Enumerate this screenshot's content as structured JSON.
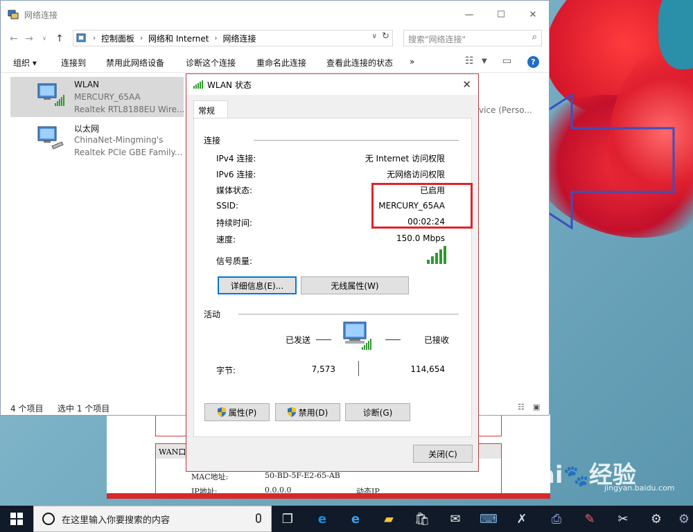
{
  "explorer": {
    "title": "网络连接",
    "window_controls": [
      "—",
      "☐",
      "✕"
    ],
    "breadcrumb": [
      "控制面板",
      "网络和 Internet",
      "网络连接"
    ],
    "search_placeholder": "搜索\"网络连接\"",
    "commands": [
      "组织 ▾",
      "连接到",
      "禁用此网络设备",
      "诊断这个连接",
      "重命名此连接",
      "查看此连接的状态",
      "»"
    ],
    "items": [
      {
        "name": "WLAN",
        "sub1": "MERCURY_65AA",
        "sub2": "Realtek RTL8188EU Wire...",
        "selected": true
      },
      {
        "name": "以太网",
        "sub1": "ChinaNet-Mingming's",
        "sub2": "Realtek PCIe GBE Family..."
      }
    ],
    "trailing_text": "vice (Perso...",
    "status_count": "4 个项目",
    "status_selected": "选中 1 个项目"
  },
  "dialog": {
    "title": "WLAN 状态",
    "tab": "常规",
    "connection_group": "连接",
    "rows": [
      {
        "label": "IPv4 连接:",
        "value": "无 Internet 访问权限"
      },
      {
        "label": "IPv6 连接:",
        "value": "无网络访问权限"
      },
      {
        "label": "媒体状态:",
        "value": "已启用"
      },
      {
        "label": "SSID:",
        "value": "MERCURY_65AA"
      },
      {
        "label": "持续时间:",
        "value": "00:02:24"
      },
      {
        "label": "速度:",
        "value": "150.0 Mbps"
      }
    ],
    "signal_label": "信号质量:",
    "signal_bars": 5,
    "details_button": "详细信息(E)...",
    "wireless_button": "无线属性(W)",
    "activity_group": "活动",
    "sent_label": "已发送",
    "received_label": "已接收",
    "bytes_label": "字节:",
    "bytes_sent": "7,573",
    "bytes_received": "114,654",
    "properties_button": "属性(P)",
    "disable_button": "禁用(D)",
    "diagnose_button": "诊断(G)",
    "close_button": "关闭(C)"
  },
  "webpage": {
    "wan_header": "WAN口状",
    "mac_label": "MAC地址:",
    "mac_value": "50-BD-5F-E2-65-AB",
    "ip_label": "IP地址:",
    "ip_value": "0.0.0.0",
    "ip_type": "动态IP"
  },
  "taskbar": {
    "search_placeholder": "在这里输入你要搜索的内容"
  },
  "watermark": {
    "brand": "Bai",
    "brand2": "经验",
    "url": "jingyan.baidu.com"
  },
  "colors": {
    "highlight_red": "#e32129",
    "arrow_blue": "#3b4fbf",
    "dialog_border": "#c0353f",
    "selection": "#d9d9d9"
  }
}
